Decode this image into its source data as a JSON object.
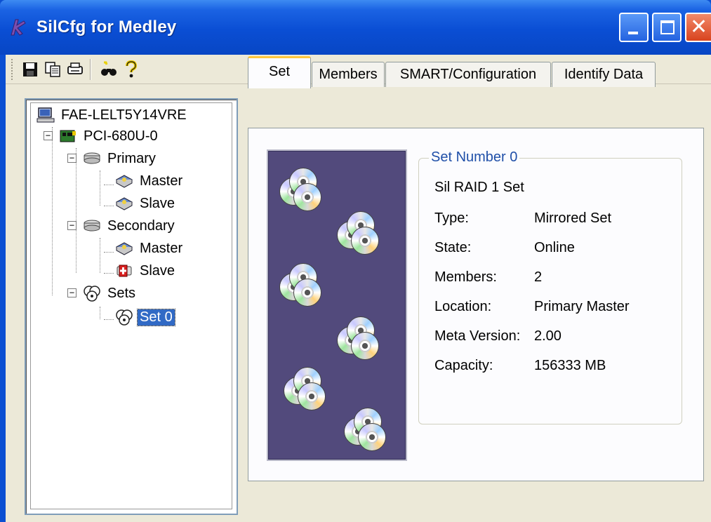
{
  "window": {
    "title": "SilCfg for Medley"
  },
  "toolbar": {
    "buttons": [
      {
        "name": "save-icon",
        "glyph": "💾"
      },
      {
        "name": "copy-icon",
        "glyph": "⎘"
      },
      {
        "name": "print-icon",
        "glyph": "▤"
      },
      {
        "name": "find-icon",
        "glyph": "🔭"
      },
      {
        "name": "help-icon",
        "glyph": "?"
      }
    ]
  },
  "tree": {
    "root": "FAE-LELT5Y14VRE",
    "controller": "PCI-680U-0",
    "primary": "Primary",
    "primary_master": "Master",
    "primary_slave": "Slave",
    "secondary": "Secondary",
    "secondary_master": "Master",
    "secondary_slave": "Slave",
    "sets": "Sets",
    "set0": "Set 0"
  },
  "tabs": {
    "set": "Set",
    "members": "Members",
    "smart": "SMART/Configuration",
    "identify": "Identify Data",
    "active": "Set"
  },
  "set_panel": {
    "group_title": "Set Number 0",
    "set_name": "Sil RAID 1 Set",
    "properties": [
      {
        "label": "Type:",
        "value": "Mirrored Set"
      },
      {
        "label": "State:",
        "value": "Online"
      },
      {
        "label": "Members:",
        "value": "2"
      },
      {
        "label": "Location:",
        "value": "Primary Master"
      },
      {
        "label": "Meta Version:",
        "value": "2.00"
      },
      {
        "label": "Capacity:",
        "value": "156333 MB"
      }
    ]
  },
  "colors": {
    "title_bar": "#0a4ed4",
    "dialog_bg": "#ece9d8",
    "picture_bg": "#524a7c",
    "selection": "#316ac5",
    "group_title": "#1f4fa8"
  }
}
